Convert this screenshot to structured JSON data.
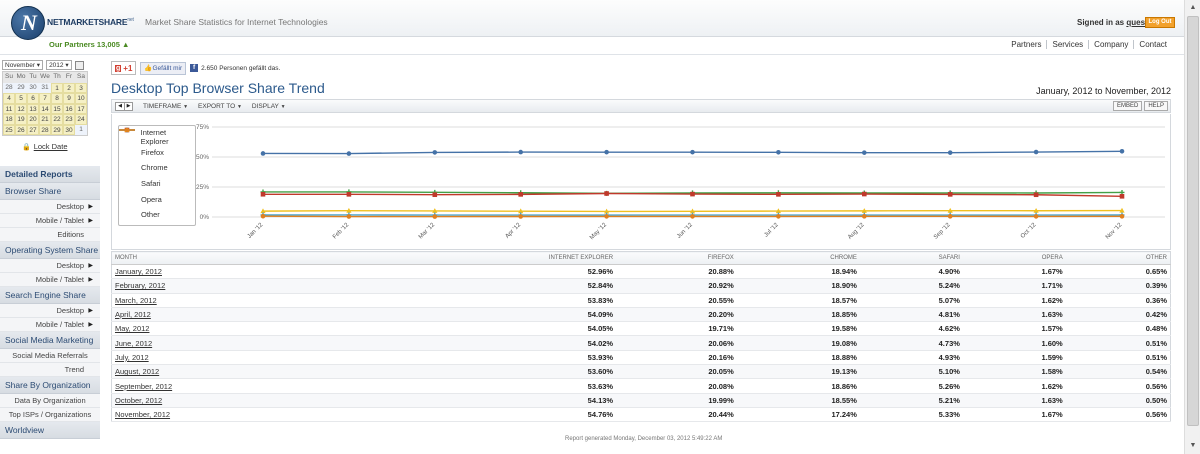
{
  "header": {
    "brand_main": "NETMARKETSHARE",
    "brand_sup": "net",
    "tagline": "Market Share Statistics for Internet Technologies",
    "signed_in_prefix": "Signed in as",
    "username": "quest",
    "logout_label": "Log Out",
    "partners": "Our Partners 13,005 ▲",
    "nav": [
      "Partners",
      "Services",
      "Company",
      "Contact"
    ]
  },
  "calendar": {
    "month": "November",
    "year": "2012",
    "day_headers": [
      "Su",
      "Mo",
      "Tu",
      "We",
      "Th",
      "Fr",
      "Sa"
    ],
    "weeks": [
      [
        "28",
        "29",
        "30",
        "31",
        "1",
        "2",
        "3"
      ],
      [
        "4",
        "5",
        "6",
        "7",
        "8",
        "9",
        "10"
      ],
      [
        "11",
        "12",
        "13",
        "14",
        "15",
        "16",
        "17"
      ],
      [
        "18",
        "19",
        "20",
        "21",
        "22",
        "23",
        "24"
      ],
      [
        "25",
        "26",
        "27",
        "28",
        "29",
        "30",
        "1"
      ]
    ],
    "lock_label": "Lock Date"
  },
  "sidebar": [
    {
      "type": "sec",
      "label": "Detailed Reports",
      "bold": true
    },
    {
      "type": "sec",
      "label": "Browser Share"
    },
    {
      "type": "item",
      "label": "Desktop",
      "arrow": true
    },
    {
      "type": "item",
      "label": "Mobile / Tablet",
      "arrow": true
    },
    {
      "type": "item",
      "label": "Editions",
      "arrow": false
    },
    {
      "type": "sec",
      "label": "Operating System Share"
    },
    {
      "type": "item",
      "label": "Desktop",
      "arrow": true
    },
    {
      "type": "item",
      "label": "Mobile / Tablet",
      "arrow": true
    },
    {
      "type": "sec",
      "label": "Search Engine Share"
    },
    {
      "type": "item",
      "label": "Desktop",
      "arrow": true
    },
    {
      "type": "item",
      "label": "Mobile / Tablet",
      "arrow": true
    },
    {
      "type": "sec",
      "label": "Social Media Marketing"
    },
    {
      "type": "item",
      "label": "Social Media Referrals",
      "arrow": false,
      "center": true
    },
    {
      "type": "item",
      "label": "Trend",
      "arrow": false
    },
    {
      "type": "sec",
      "label": "Share By Organization"
    },
    {
      "type": "item",
      "label": "Data By Organization",
      "arrow": false,
      "center": true
    },
    {
      "type": "item",
      "label": "Top ISPs / Organizations",
      "arrow": false,
      "center": true
    },
    {
      "type": "sec",
      "label": "Worldview"
    }
  ],
  "social": {
    "gplus_label": "+1",
    "like_label": "Gefällt mir",
    "fb_text": "2.650 Personen gefällt das."
  },
  "report": {
    "title": "Desktop Top Browser Share Trend",
    "date_range": "January, 2012 to November, 2012",
    "toolbar": [
      "TIMEFRAME",
      "EXPORT TO",
      "DISPLAY"
    ],
    "embed_label": "EMBED",
    "help_label": "HELP",
    "footer": "Report generated Monday, December 03, 2012 5:49:22 AM"
  },
  "colors": {
    "Internet Explorer": "#4572a7",
    "Firefox": "#43a047",
    "Chrome": "#c0392b",
    "Safari": "#f0c020",
    "Opera": "#4aa3c8",
    "Other": "#e08020"
  },
  "chart_data": {
    "type": "line",
    "x": [
      "Jan '12",
      "Feb '12",
      "Mar '12",
      "Apr '12",
      "May '12",
      "Jun '12",
      "Jul '12",
      "Aug '12",
      "Sep '12",
      "Oct '12",
      "Nov '12"
    ],
    "ylim": [
      0,
      75
    ],
    "yticks": [
      "0%",
      "25%",
      "50%",
      "75%"
    ],
    "grid": true,
    "legend": "left",
    "series": [
      {
        "name": "Internet Explorer",
        "marker": "circle",
        "values": [
          52.96,
          52.84,
          53.83,
          54.09,
          54.05,
          54.02,
          53.93,
          53.6,
          53.63,
          54.13,
          54.76
        ]
      },
      {
        "name": "Firefox",
        "marker": "plus",
        "values": [
          20.88,
          20.92,
          20.55,
          20.2,
          19.71,
          20.06,
          20.16,
          20.05,
          20.08,
          19.99,
          20.44
        ]
      },
      {
        "name": "Chrome",
        "marker": "square",
        "values": [
          18.94,
          18.9,
          18.57,
          18.85,
          19.58,
          19.08,
          18.88,
          19.13,
          18.86,
          18.55,
          17.24
        ]
      },
      {
        "name": "Safari",
        "marker": "triangle",
        "values": [
          4.9,
          5.24,
          5.07,
          4.81,
          4.62,
          4.73,
          4.93,
          5.1,
          5.26,
          5.21,
          5.33
        ]
      },
      {
        "name": "Opera",
        "marker": "plus",
        "values": [
          1.67,
          1.71,
          1.62,
          1.63,
          1.57,
          1.6,
          1.59,
          1.58,
          1.62,
          1.63,
          1.67
        ]
      },
      {
        "name": "Other",
        "marker": "circle",
        "values": [
          0.65,
          0.39,
          0.36,
          0.42,
          0.48,
          0.51,
          0.51,
          0.54,
          0.56,
          0.5,
          0.56
        ]
      }
    ]
  },
  "table": {
    "headers": [
      "MONTH",
      "INTERNET EXPLORER",
      "FIREFOX",
      "CHROME",
      "SAFARI",
      "OPERA",
      "OTHER"
    ],
    "rows": [
      [
        "January, 2012",
        "52.96%",
        "20.88%",
        "18.94%",
        "4.90%",
        "1.67%",
        "0.65%"
      ],
      [
        "February, 2012",
        "52.84%",
        "20.92%",
        "18.90%",
        "5.24%",
        "1.71%",
        "0.39%"
      ],
      [
        "March, 2012",
        "53.83%",
        "20.55%",
        "18.57%",
        "5.07%",
        "1.62%",
        "0.36%"
      ],
      [
        "April, 2012",
        "54.09%",
        "20.20%",
        "18.85%",
        "4.81%",
        "1.63%",
        "0.42%"
      ],
      [
        "May, 2012",
        "54.05%",
        "19.71%",
        "19.58%",
        "4.62%",
        "1.57%",
        "0.48%"
      ],
      [
        "June, 2012",
        "54.02%",
        "20.06%",
        "19.08%",
        "4.73%",
        "1.60%",
        "0.51%"
      ],
      [
        "July, 2012",
        "53.93%",
        "20.16%",
        "18.88%",
        "4.93%",
        "1.59%",
        "0.51%"
      ],
      [
        "August, 2012",
        "53.60%",
        "20.05%",
        "19.13%",
        "5.10%",
        "1.58%",
        "0.54%"
      ],
      [
        "September, 2012",
        "53.63%",
        "20.08%",
        "18.86%",
        "5.26%",
        "1.62%",
        "0.56%"
      ],
      [
        "October, 2012",
        "54.13%",
        "19.99%",
        "18.55%",
        "5.21%",
        "1.63%",
        "0.50%"
      ],
      [
        "November, 2012",
        "54.76%",
        "20.44%",
        "17.24%",
        "5.33%",
        "1.67%",
        "0.56%"
      ]
    ]
  }
}
